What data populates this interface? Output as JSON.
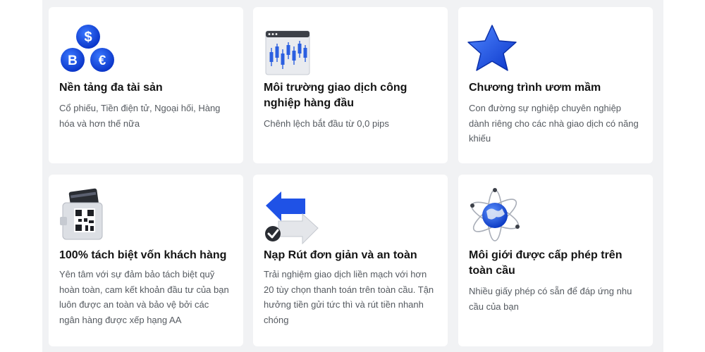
{
  "features": [
    {
      "icon": "crypto-coins-icon",
      "title": "Nền tảng đa tài sản",
      "description": "Cổ phiếu, Tiền điện tử, Ngoại hối, Hàng hóa và hơn thế nữa"
    },
    {
      "icon": "candlestick-chart-icon",
      "title": "Môi trường giao dịch công nghiệp hàng đầu",
      "description": "Chênh lệch bắt đầu từ 0,0 pips"
    },
    {
      "icon": "star-icon",
      "title": "Chương trình ươm mầm",
      "description": "Con đường sự nghiệp chuyên nghiệp dành riêng cho các nhà giao dịch có năng khiếu"
    },
    {
      "icon": "wallet-qr-icon",
      "title": "100% tách biệt vốn khách hàng",
      "description": "Yên tâm với sự đảm bảo tách biệt quỹ hoàn toàn, cam kết khoản đầu tư của bạn luôn được an toàn và bảo vệ bởi các ngân hàng được xếp hạng AA"
    },
    {
      "icon": "transfer-arrows-icon",
      "title": "Nạp Rút đơn giản và an toàn",
      "description": "Trải nghiệm giao dịch liền mạch với hơn 20 tùy chọn thanh toán trên toàn cầu. Tận hưởng tiền gửi tức thì và rút tiền nhanh chóng"
    },
    {
      "icon": "globe-orbit-icon",
      "title": "Môi giới được cấp phép trên toàn cầu",
      "description": "Nhiều giấy phép có sẵn để đáp ứng nhu cầu của bạn"
    }
  ]
}
